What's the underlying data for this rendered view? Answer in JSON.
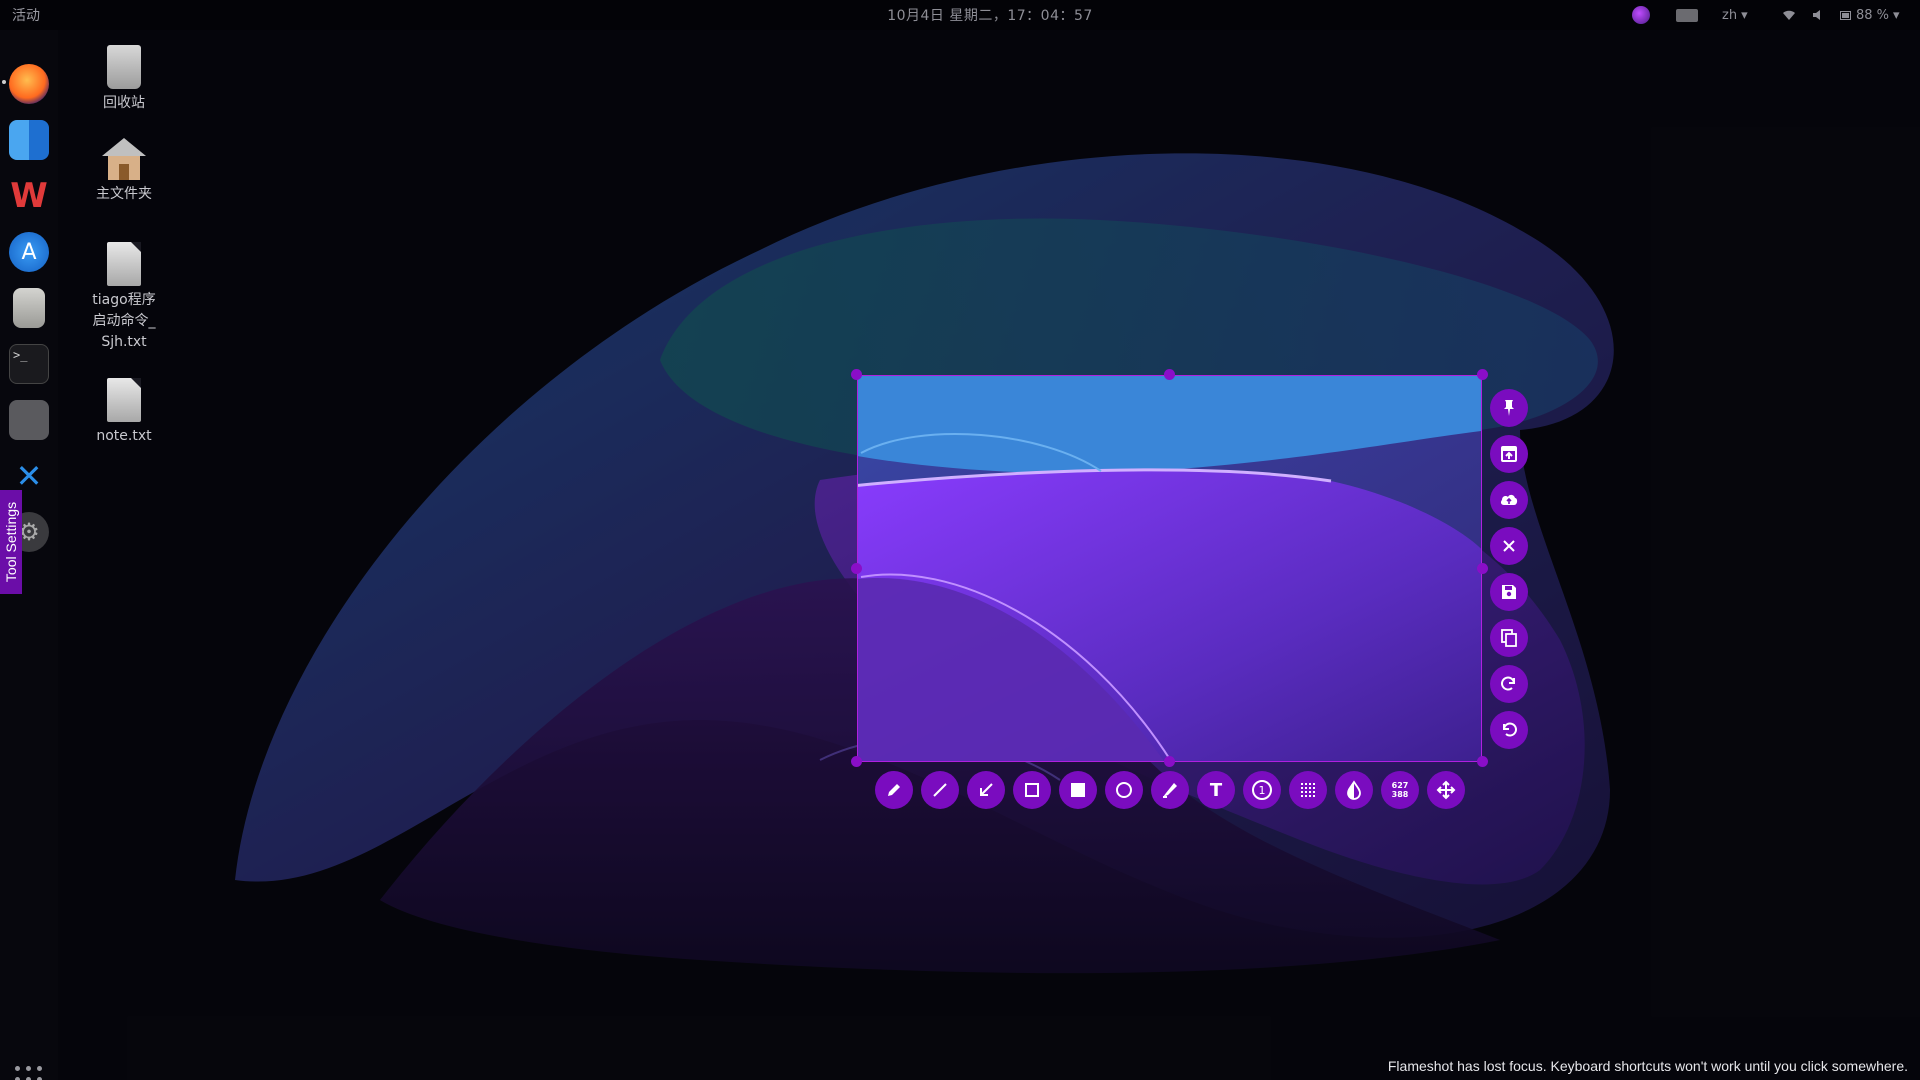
{
  "topbar": {
    "activities": "活动",
    "clock": "10月4日 星期二，17：04：57",
    "language": "zh",
    "battery": "88 %",
    "language_caret": "▾",
    "battery_caret": "▾"
  },
  "dock": {
    "apps": [
      "firefox-icon",
      "finder-icon",
      "wps-office-icon",
      "app-store-icon",
      "text-editor-icon",
      "terminal-icon",
      "screenshot-icon",
      "vscode-icon",
      "settings-icon"
    ],
    "terminal_glyph": ">_",
    "wps_glyph": "W",
    "vscode_glyph": "✕",
    "appstore_glyph": "A",
    "settings_glyph": "⚙"
  },
  "tool_settings": {
    "label": "Tool Settings"
  },
  "desktop": {
    "icons": [
      {
        "label": "回收站"
      },
      {
        "label": "主文件夹"
      },
      {
        "label": "tiago程序启动命令_Sjh.txt"
      },
      {
        "label": "note.txt"
      }
    ]
  },
  "flameshot": {
    "accent": "#7a0cbf",
    "selection_size": {
      "width": "627",
      "height": "388"
    },
    "side_tools": [
      "pin-icon",
      "app-launcher-icon",
      "upload-icon",
      "close-icon",
      "save-icon",
      "copy-icon",
      "redo-icon",
      "undo-icon"
    ],
    "bottom_tools": [
      "pencil-icon",
      "line-icon",
      "arrow-icon",
      "rectangle-icon",
      "filled-rectangle-icon",
      "circle-icon",
      "marker-icon",
      "text-icon",
      "circle-counter-icon",
      "pixelate-icon",
      "invert-icon",
      "size-readout",
      "move-icon"
    ],
    "text_tool_glyph": "T",
    "counter_glyph": "1"
  },
  "notification": {
    "text": "Flameshot has lost focus. Keyboard shortcuts won't work until you click somewhere."
  }
}
